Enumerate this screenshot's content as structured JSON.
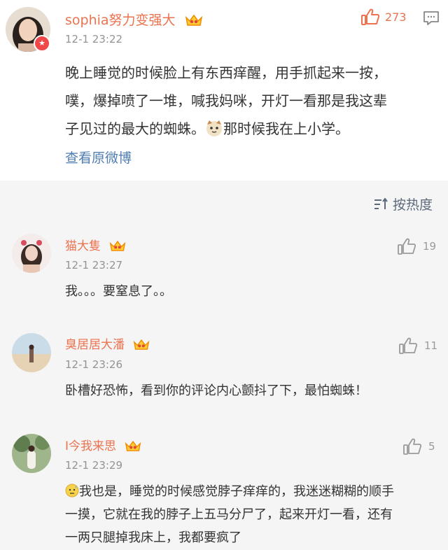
{
  "main_comment": {
    "username": "sophia努力变强大",
    "timestamp": "12-1 23:22",
    "like_count": "273",
    "text_line1": "晚上睡觉的时候脸上有东西痒醒，用手抓起来一按，",
    "text_line2": "噗，爆掉喷了一堆，喊我妈咪，开灯一看那是我这辈",
    "text_line3_a": "子见过的最大的蜘蛛。",
    "text_line3_b": "那时候我在上小学。",
    "view_original": "查看原微博"
  },
  "sort": {
    "label": "按热度"
  },
  "replies": [
    {
      "username": "猫大隻",
      "timestamp": "12-1 23:27",
      "likes": "19",
      "text": "我。。。要窒息了。。"
    },
    {
      "username": "臭居居大潘",
      "timestamp": "12-1 23:26",
      "likes": "11",
      "text": "卧槽好恐怖，看到你的评论内心颤抖了下，最怕蜘蛛！"
    },
    {
      "username": "I今我来思",
      "timestamp": "12-1 23:29",
      "likes": "5",
      "text_line1": "我也是，睡觉的时候感觉脖子痒痒的，我迷迷糊糊的顺手",
      "text_line2": "一摸，它就在我的脖子上五马分尸了，起来开灯一看，还有",
      "text_line3": "一两只腿掉我床上，我都要疯了"
    }
  ],
  "colors": {
    "username": "#eb7350",
    "link": "#507daf",
    "like_active": "#eb7350",
    "like_inactive": "#9a9a9a",
    "timestamp": "#939393",
    "band": "#f5f5f5"
  },
  "icons": {
    "vip": "vip-crown-icon",
    "like": "thumbs-up-icon",
    "comment": "comment-bubble-icon",
    "sort": "sort-icon",
    "emoji_cat": "cat-emoji-icon",
    "emoji_sweat": "sweat-emoji-icon",
    "badge": "verified-badge-icon"
  }
}
